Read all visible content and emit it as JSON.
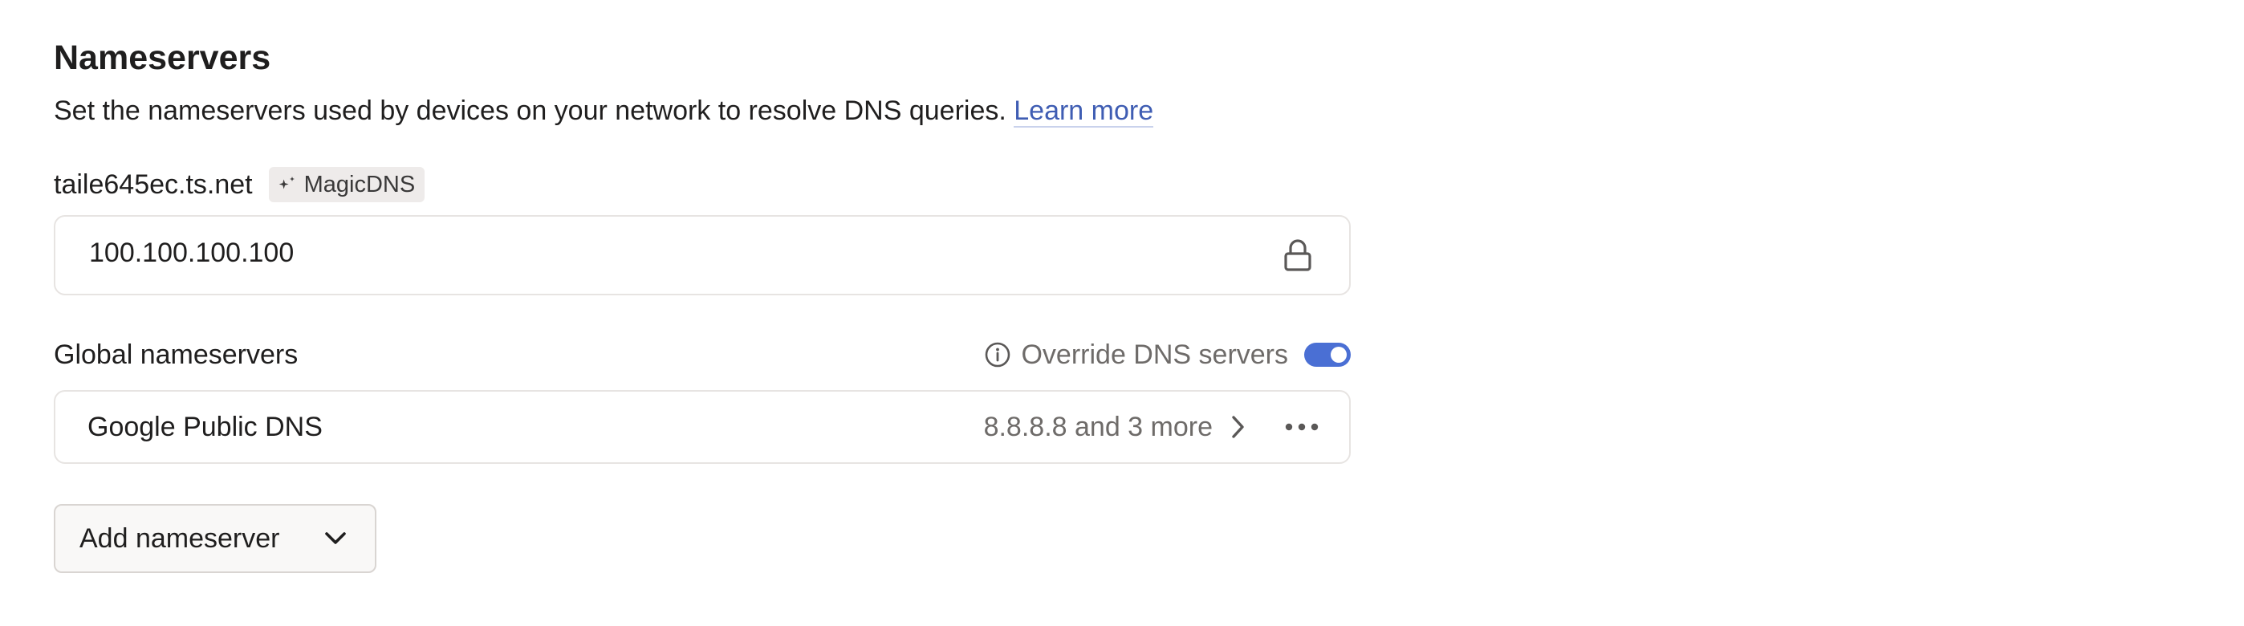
{
  "section": {
    "title": "Nameservers",
    "description": "Set the nameservers used by devices on your network to resolve DNS queries.",
    "learn_more": "Learn more"
  },
  "tailnet": {
    "name": "taile645ec.ts.net",
    "badge_label": "MagicDNS",
    "badge_icon": "sparkle-icon",
    "locked_value": "100.100.100.100",
    "lock_icon": "lock-icon"
  },
  "global": {
    "label": "Global nameservers",
    "override_label": "Override DNS servers",
    "override_enabled": true,
    "info_icon": "info-icon"
  },
  "nameservers": [
    {
      "name": "Google Public DNS",
      "summary": "8.8.8.8 and 3 more"
    }
  ],
  "add_button": {
    "label": "Add nameserver",
    "icon": "chevron-down-icon"
  },
  "colors": {
    "link": "#3f5db3",
    "toggle_on": "#4a6fd4",
    "border": "#e7e4e2",
    "muted_text": "#6e6b69"
  }
}
